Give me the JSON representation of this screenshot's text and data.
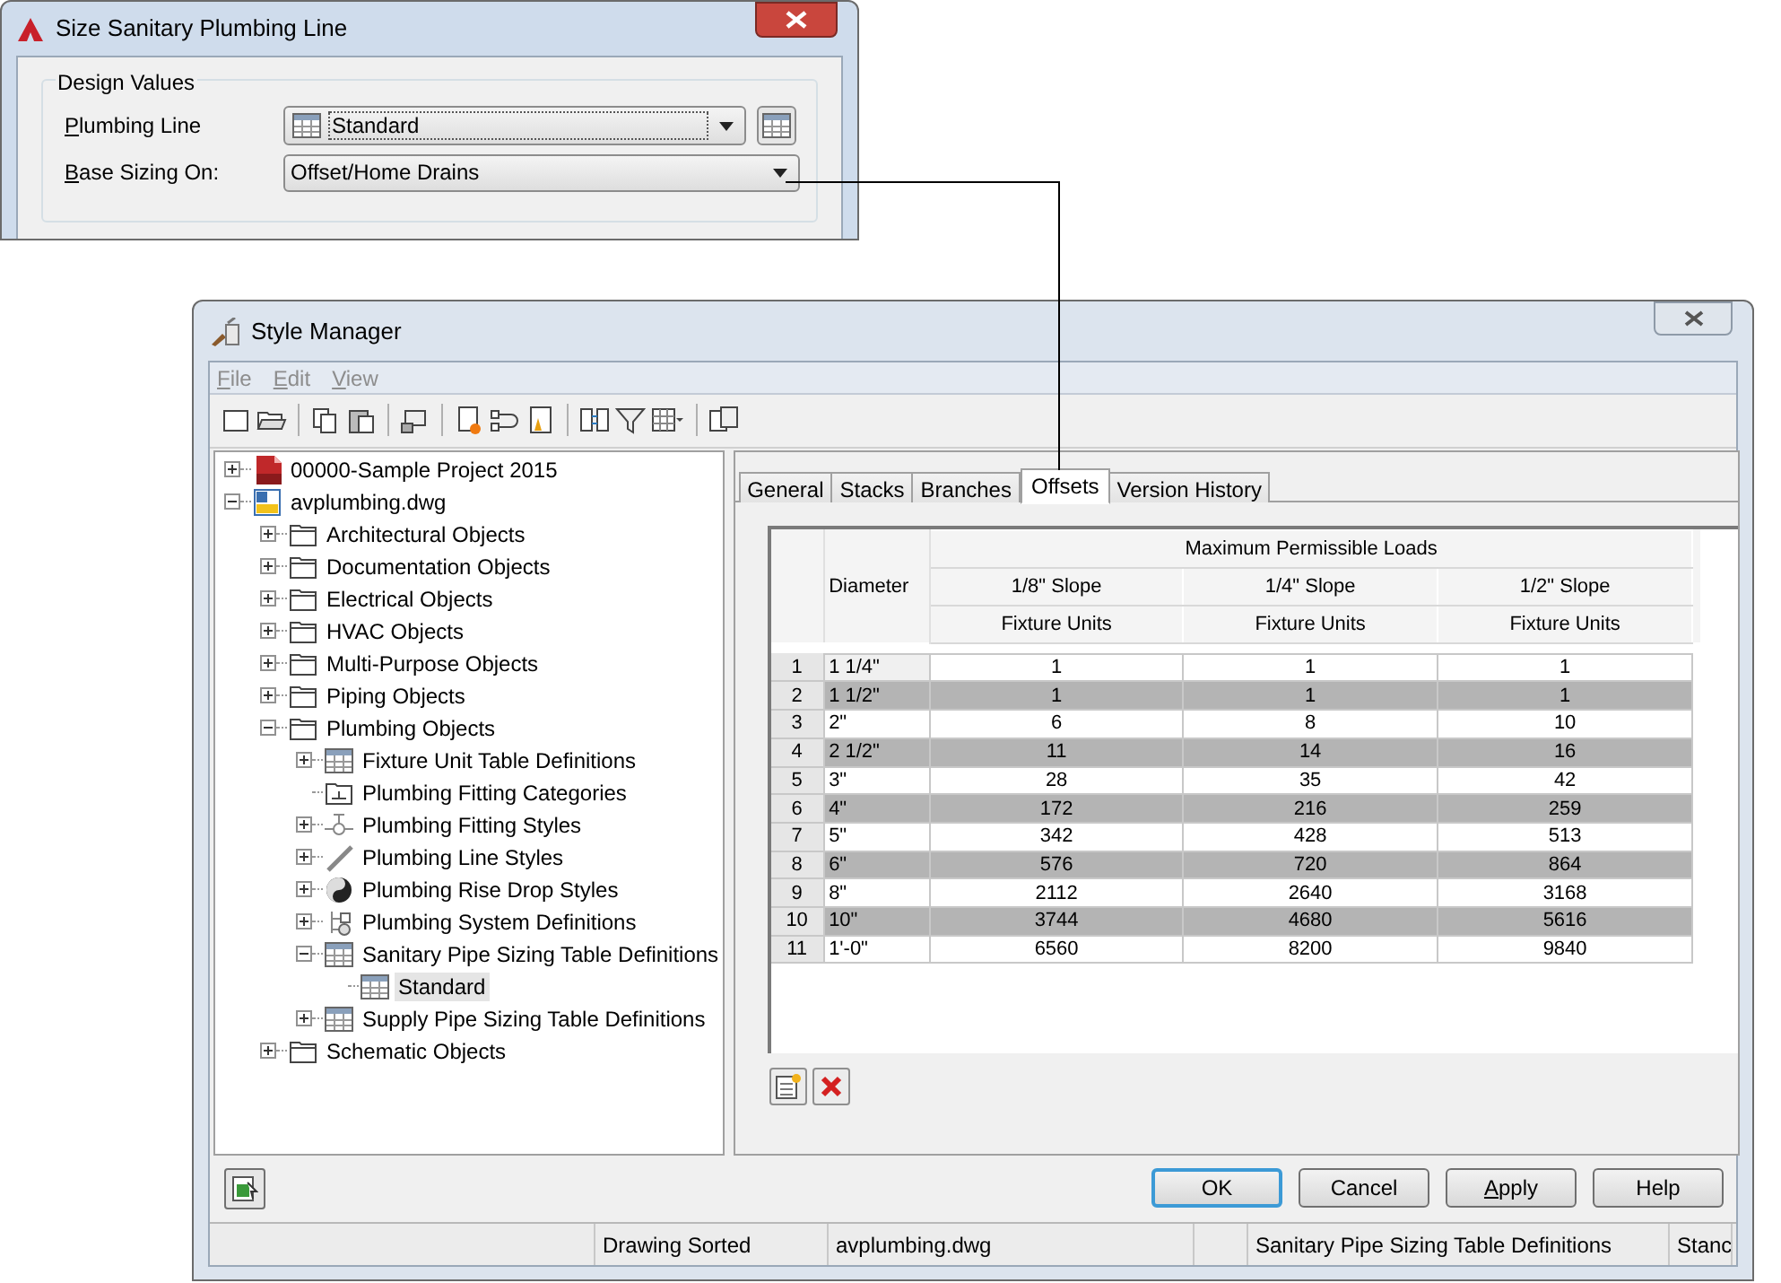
{
  "dialog": {
    "title": "Size Sanitary Plumbing Line",
    "group": "Design Values",
    "fields": [
      {
        "label": "Plumbing Line",
        "value": "Standard",
        "kind": "style-combo"
      },
      {
        "label": "Base Sizing On:",
        "value": "Offset/Home Drains",
        "kind": "combo"
      }
    ]
  },
  "style_manager": {
    "title": "Style Manager",
    "menu": [
      {
        "label": "File",
        "disabled": true
      },
      {
        "label": "Edit",
        "disabled": true
      },
      {
        "label": "View",
        "disabled": true
      }
    ],
    "tree": [
      {
        "label": "00000-Sample Project 2015",
        "kind": "project",
        "expanded": false,
        "selected": false
      },
      {
        "label": "avplumbing.dwg",
        "kind": "drawing",
        "expanded": true,
        "selected": false,
        "children": [
          {
            "label": "Architectural Objects",
            "kind": "folder",
            "expanded": false,
            "selected": false
          },
          {
            "label": "Documentation Objects",
            "kind": "folder",
            "expanded": false,
            "selected": false
          },
          {
            "label": "Electrical Objects",
            "kind": "folder",
            "expanded": false,
            "selected": false
          },
          {
            "label": "HVAC Objects",
            "kind": "folder",
            "expanded": false,
            "selected": false
          },
          {
            "label": "Multi-Purpose Objects",
            "kind": "folder",
            "expanded": false,
            "selected": false
          },
          {
            "label": "Piping Objects",
            "kind": "folder",
            "expanded": false,
            "selected": false
          },
          {
            "label": "Plumbing Objects",
            "kind": "folder",
            "expanded": true,
            "selected": false,
            "children": [
              {
                "label": "Fixture Unit Table Definitions",
                "kind": "table",
                "expanded": false,
                "selected": false
              },
              {
                "label": "Plumbing Fitting Categories",
                "kind": "category",
                "selected": false
              },
              {
                "label": "Plumbing Fitting Styles",
                "kind": "fitting",
                "expanded": false,
                "selected": false
              },
              {
                "label": "Plumbing Line Styles",
                "kind": "line",
                "expanded": false,
                "selected": false
              },
              {
                "label": "Plumbing Rise Drop Styles",
                "kind": "risedrop",
                "expanded": false,
                "selected": false
              },
              {
                "label": "Plumbing System Definitions",
                "kind": "system",
                "expanded": false,
                "selected": false
              },
              {
                "label": "Sanitary Pipe Sizing Table Definitions",
                "kind": "table",
                "expanded": true,
                "selected": false,
                "children": [
                  {
                    "label": "Standard",
                    "kind": "table",
                    "selected": true
                  }
                ]
              },
              {
                "label": "Supply Pipe Sizing Table Definitions",
                "kind": "table",
                "expanded": false,
                "selected": false
              }
            ]
          },
          {
            "label": "Schematic Objects",
            "kind": "folder",
            "expanded": false,
            "selected": false
          }
        ]
      }
    ],
    "tabs": [
      {
        "label": "General",
        "selected": false
      },
      {
        "label": "Stacks",
        "selected": false
      },
      {
        "label": "Branches",
        "selected": false
      },
      {
        "label": "Offsets",
        "selected": true
      },
      {
        "label": "Version History",
        "selected": false
      }
    ],
    "table": {
      "diameter_header": "Diameter",
      "group_header": "Maximum Permissible Loads",
      "columns": [
        {
          "slope": "1/8\" Slope",
          "unit": "Fixture Units"
        },
        {
          "slope": "1/4\" Slope",
          "unit": "Fixture Units"
        },
        {
          "slope": "1/2\" Slope",
          "unit": "Fixture Units"
        }
      ],
      "rows": [
        {
          "number": "1",
          "diameter": "1 1/4\"",
          "values": [
            "1",
            "1",
            "1"
          ]
        },
        {
          "number": "2",
          "diameter": "1 1/2\"",
          "values": [
            "1",
            "1",
            "1"
          ]
        },
        {
          "number": "3",
          "diameter": "2\"",
          "values": [
            "6",
            "8",
            "10"
          ]
        },
        {
          "number": "4",
          "diameter": "2 1/2\"",
          "values": [
            "11",
            "14",
            "16"
          ]
        },
        {
          "number": "5",
          "diameter": "3\"",
          "values": [
            "28",
            "35",
            "42"
          ]
        },
        {
          "number": "6",
          "diameter": "4\"",
          "values": [
            "172",
            "216",
            "259"
          ]
        },
        {
          "number": "7",
          "diameter": "5\"",
          "values": [
            "342",
            "428",
            "513"
          ]
        },
        {
          "number": "8",
          "diameter": "6\"",
          "values": [
            "576",
            "720",
            "864"
          ]
        },
        {
          "number": "9",
          "diameter": "8\"",
          "values": [
            "2112",
            "2640",
            "3168"
          ]
        },
        {
          "number": "10",
          "diameter": "10\"",
          "values": [
            "3744",
            "4680",
            "5616"
          ]
        },
        {
          "number": "11",
          "diameter": "1'-0\"",
          "values": [
            "6560",
            "8200",
            "9840"
          ]
        }
      ]
    },
    "buttons": [
      {
        "label": "OK",
        "default": true
      },
      {
        "label": "Cancel",
        "default": false
      },
      {
        "label": "Apply",
        "default": false
      },
      {
        "label": "Help",
        "default": false
      }
    ],
    "status_bar": [
      "Drawing Sorted",
      "avplumbing.dwg",
      "Sanitary Pipe Sizing Table Definitions",
      "Stanc"
    ]
  }
}
